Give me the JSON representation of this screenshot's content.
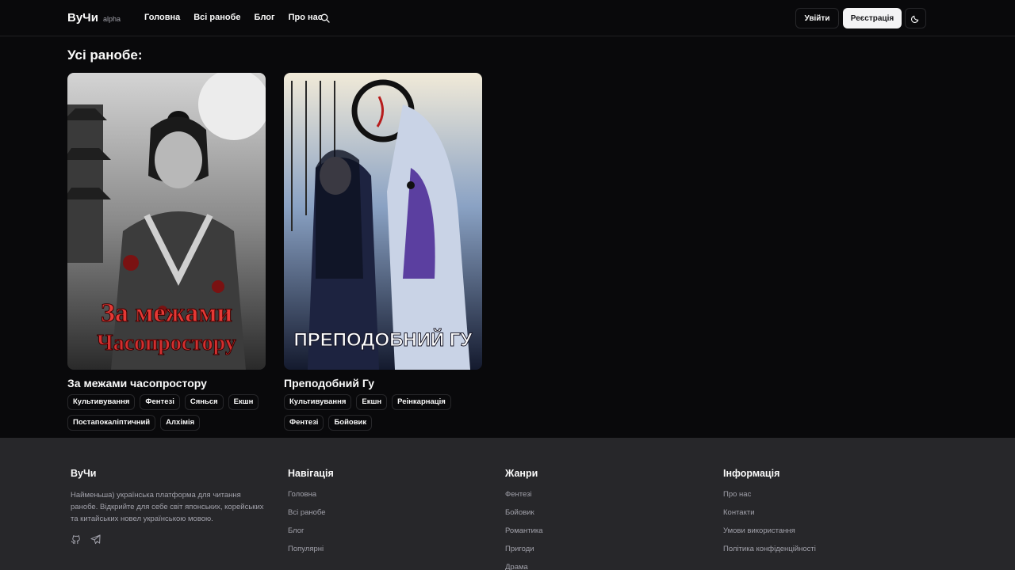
{
  "header": {
    "brand": "ВуЧи",
    "brand_tag": "alpha",
    "nav": [
      "Головна",
      "Всі ранобе",
      "Блог",
      "Про нас"
    ],
    "search_icon": "search-icon",
    "login_label": "Увійти",
    "register_label": "Реєстрація",
    "theme_icon": "moon-icon"
  },
  "main": {
    "title": "Усі ранобе:",
    "novels": [
      {
        "title": "За межами часопростору",
        "cover_text_line1": "За межами",
        "cover_text_line2": "Часопростору",
        "tags": [
          "Культивування",
          "Фентезі",
          "Сянься",
          "Екшн",
          "Постапокаліптичний",
          "Алхімія"
        ]
      },
      {
        "title": "Преподобний Гу",
        "cover_text_line1": "ПРЕПОДОБНИЙ ГУ",
        "tags": [
          "Культивування",
          "Екшн",
          "Реінкарнація",
          "Фентезі",
          "Бойовик"
        ]
      }
    ]
  },
  "footer": {
    "about": {
      "heading": "ВуЧи",
      "description": "Найменьша) українська платформа для читання ранобе. Відкрийте для себе світ японських, корейських та китайських новел українською мовою.",
      "social_icons": [
        "github-icon",
        "telegram-icon"
      ]
    },
    "navigation": {
      "heading": "Навігація",
      "links": [
        "Головна",
        "Всі ранобе",
        "Блог",
        "Популярні"
      ]
    },
    "genres": {
      "heading": "Жанри",
      "links": [
        "Фентезі",
        "Бойовик",
        "Романтика",
        "Пригоди",
        "Драма"
      ]
    },
    "info": {
      "heading": "Інформація",
      "links": [
        "Про нас",
        "Контакти",
        "Умови використання",
        "Політика конфіденційності"
      ]
    }
  }
}
